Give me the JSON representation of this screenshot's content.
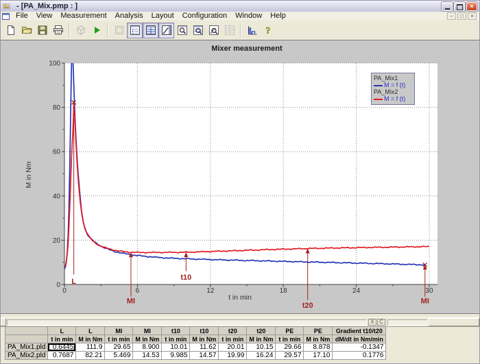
{
  "window": {
    "title": " - [PA_Mix.pmp : ]"
  },
  "menu": {
    "items": [
      "File",
      "View",
      "Measurement",
      "Analysis",
      "Layout",
      "Configuration",
      "Window",
      "Help"
    ]
  },
  "toolbar": {
    "buttons": [
      {
        "icon": "new-document-icon",
        "state": "normal"
      },
      {
        "icon": "open-folder-icon",
        "state": "normal"
      },
      {
        "icon": "save-floppy-icon",
        "state": "normal"
      },
      {
        "icon": "print-icon",
        "state": "normal"
      },
      {
        "icon": "mixer-head-icon",
        "state": "disabled"
      },
      {
        "icon": "start-measurement-play-icon",
        "state": "normal"
      },
      {
        "icon": "blank-window-icon",
        "state": "disabled"
      },
      {
        "icon": "protocol-view-icon",
        "state": "pressed"
      },
      {
        "icon": "table-view-icon",
        "state": "pressed"
      },
      {
        "icon": "graph-view-icon",
        "state": "pressed"
      },
      {
        "icon": "zoom-window-icon",
        "state": "normal"
      },
      {
        "icon": "zoom-table-icon",
        "state": "normal"
      },
      {
        "icon": "zoom-graph-icon",
        "state": "normal"
      },
      {
        "icon": "table-extra-icon",
        "state": "disabled"
      },
      {
        "icon": "evaluation-histogram-icon",
        "state": "normal"
      },
      {
        "icon": "help-icon",
        "state": "normal"
      }
    ]
  },
  "chart_data": {
    "type": "line",
    "title": "Mixer measurement",
    "xlabel": "t in min",
    "ylabel": "M in Nm",
    "xlim": [
      0,
      30
    ],
    "ylim": [
      0,
      100
    ],
    "x_ticks": [
      0,
      6,
      12,
      18,
      24,
      30
    ],
    "y_ticks": [
      0,
      20,
      40,
      60,
      80,
      100
    ],
    "grid": "dotted",
    "legend_position": "top-right",
    "marker_color": "#a32222",
    "series": [
      {
        "name": "PA_Mix1",
        "legend_label": "M = f (t)",
        "color": "#2535b5",
        "points": [
          [
            0,
            7
          ],
          [
            0.08,
            8
          ],
          [
            0.15,
            10
          ],
          [
            0.22,
            14
          ],
          [
            0.3,
            22
          ],
          [
            0.36,
            33
          ],
          [
            0.42,
            48
          ],
          [
            0.47,
            63
          ],
          [
            0.52,
            80
          ],
          [
            0.56,
            93
          ],
          [
            0.6,
            103
          ],
          [
            0.68,
            104
          ],
          [
            0.73,
            97
          ],
          [
            0.8,
            85
          ],
          [
            0.9,
            71
          ],
          [
            1.0,
            61
          ],
          [
            1.1,
            52
          ],
          [
            1.25,
            42
          ],
          [
            1.4,
            33.5
          ],
          [
            1.55,
            28
          ],
          [
            1.7,
            25
          ],
          [
            1.9,
            22.5
          ],
          [
            2.1,
            21
          ],
          [
            2.4,
            19.5
          ],
          [
            2.7,
            18.3
          ],
          [
            3.0,
            17.3
          ],
          [
            3.4,
            16.3
          ],
          [
            3.8,
            15.5
          ],
          [
            4.2,
            14.8
          ],
          [
            4.7,
            14.2
          ],
          [
            5.2,
            13.7
          ],
          [
            5.8,
            13.2
          ],
          [
            6.5,
            12.8
          ],
          [
            7.5,
            12.3
          ],
          [
            8.5,
            11.95
          ],
          [
            10.0,
            11.62
          ],
          [
            11.5,
            11.35
          ],
          [
            13,
            11.1
          ],
          [
            14.5,
            10.9
          ],
          [
            16,
            10.7
          ],
          [
            17.5,
            10.5
          ],
          [
            19,
            10.3
          ],
          [
            20,
            10.15
          ],
          [
            21.5,
            10.0
          ],
          [
            23,
            9.8
          ],
          [
            24.5,
            9.6
          ],
          [
            26,
            9.4
          ],
          [
            27.5,
            9.2
          ],
          [
            28.7,
            9.0
          ],
          [
            29.65,
            8.9
          ]
        ]
      },
      {
        "name": "PA_Mix2",
        "legend_label": "M = f (t)",
        "color": "#e31b23",
        "points": [
          [
            0,
            8
          ],
          [
            0.1,
            9
          ],
          [
            0.2,
            12
          ],
          [
            0.3,
            18
          ],
          [
            0.38,
            27
          ],
          [
            0.45,
            37
          ],
          [
            0.52,
            48
          ],
          [
            0.58,
            57
          ],
          [
            0.63,
            63
          ],
          [
            0.68,
            68
          ],
          [
            0.72,
            73
          ],
          [
            0.77,
            82.2
          ],
          [
            0.82,
            78
          ],
          [
            0.88,
            72
          ],
          [
            0.95,
            64
          ],
          [
            1.05,
            54
          ],
          [
            1.15,
            46
          ],
          [
            1.3,
            37
          ],
          [
            1.45,
            31
          ],
          [
            1.6,
            27
          ],
          [
            1.8,
            23.8
          ],
          [
            2.0,
            21.8
          ],
          [
            2.3,
            19.8
          ],
          [
            2.6,
            18.5
          ],
          [
            3.0,
            17.3
          ],
          [
            3.4,
            16.5
          ],
          [
            3.8,
            15.9
          ],
          [
            4.3,
            15.3
          ],
          [
            4.8,
            14.9
          ],
          [
            5.47,
            14.53
          ],
          [
            6.2,
            14.45
          ],
          [
            7,
            14.45
          ],
          [
            8,
            14.48
          ],
          [
            9,
            14.5
          ],
          [
            10,
            14.57
          ],
          [
            11,
            14.72
          ],
          [
            12,
            14.9
          ],
          [
            13.5,
            15.15
          ],
          [
            15,
            15.45
          ],
          [
            16.5,
            15.7
          ],
          [
            18,
            15.95
          ],
          [
            19,
            16.1
          ],
          [
            20,
            16.24
          ],
          [
            21.5,
            16.4
          ],
          [
            23,
            16.55
          ],
          [
            24.5,
            16.68
          ],
          [
            26,
            16.8
          ],
          [
            27.5,
            16.92
          ],
          [
            28.5,
            17.0
          ],
          [
            29.57,
            17.1
          ],
          [
            30,
            17.1
          ]
        ]
      }
    ],
    "markers": [
      {
        "label": "L",
        "t": 0.7687,
        "top_m": 75,
        "bottom_m": 4.5,
        "label_m": 0.3,
        "arrow": false
      },
      {
        "label": "MI",
        "t": 5.469,
        "top_m": 14.53,
        "bottom_m": -5.5,
        "label_m": -8.5,
        "arrow": true
      },
      {
        "label": "t10",
        "t": 10.0,
        "top_m": 14.57,
        "bottom_m": 6,
        "label_m": 2.2,
        "arrow": true
      },
      {
        "label": "t20",
        "t": 20.0,
        "top_m": 16.24,
        "bottom_m": -7,
        "label_m": -10.5,
        "arrow": true
      },
      {
        "label": "MI",
        "t": 29.65,
        "top_m": 8.9,
        "bottom_m": -5.5,
        "label_m": -8.5,
        "arrow": true
      }
    ],
    "point_markers": [
      {
        "t": 0.7687,
        "m": 82.21
      },
      {
        "t": 29.65,
        "m": 8.9
      }
    ]
  },
  "panel_bar": {
    "close_label": "X",
    "copy_label": "C"
  },
  "table": {
    "header_row1": [
      "L",
      "L",
      "MI",
      "MI",
      "t10",
      "t10",
      "t20",
      "t20",
      "PE",
      "PE",
      "Gradient t10/t20"
    ],
    "header_row2": [
      "t in min",
      "M in Nm",
      "t in min",
      "M in Nm",
      "t in min",
      "M in Nm",
      "t in min",
      "M in Nm",
      "t in min",
      "M in Nm",
      "dM/dt in Nm/min"
    ],
    "rows": [
      {
        "name": "PA_Mix1.pld",
        "values": [
          "0.6445",
          "111.9",
          "29.65",
          "8.900",
          "10.01",
          "11.62",
          "20.01",
          "10.15",
          "29.66",
          "8.878",
          "-0.1347"
        ]
      },
      {
        "name": "PA_Mix2.pld",
        "values": [
          "0.7687",
          "82.21",
          "5.469",
          "14.53",
          "9.985",
          "14.57",
          "19.99",
          "16.24",
          "29.57",
          "17.10",
          "0.1776"
        ]
      }
    ],
    "selected_cell": {
      "row": 0,
      "col": 0
    }
  }
}
